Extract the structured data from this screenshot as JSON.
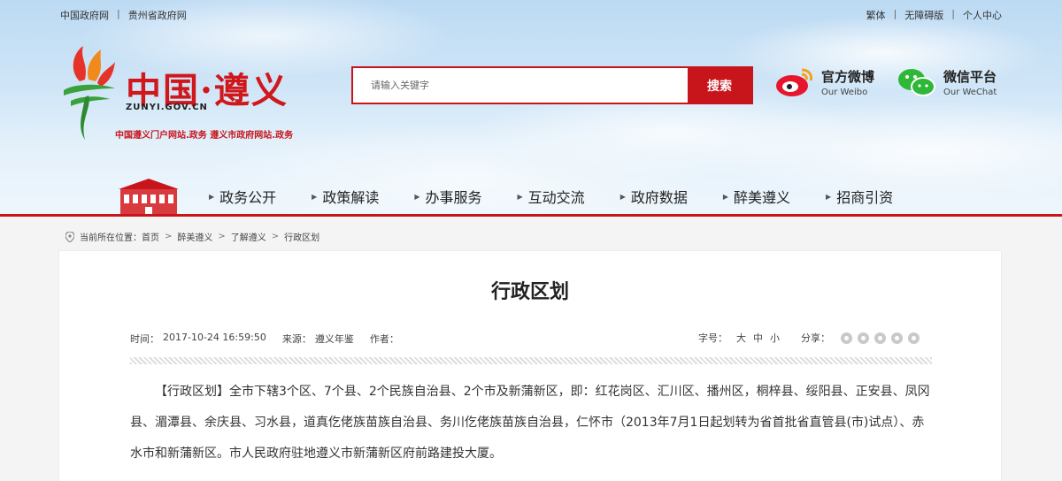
{
  "topbar": {
    "left_links": [
      "中国政府网",
      "贵州省政府网"
    ],
    "right_links": [
      "繁体",
      "无障碍版",
      "个人中心"
    ]
  },
  "logo": {
    "title": "中国·遵义",
    "url_text": "ZUNYI.GOV.CN",
    "subtitle": "中国遵义门户网站.政务  遵义市政府网站.政务"
  },
  "search": {
    "placeholder": "请输入关键字",
    "button_label": "搜索"
  },
  "social": {
    "weibo": {
      "title": "官方微博",
      "subtitle": "Our Weibo"
    },
    "wechat": {
      "title": "微信平台",
      "subtitle": "Our WeChat"
    }
  },
  "nav": {
    "items": [
      "政务公开",
      "政策解读",
      "办事服务",
      "互动交流",
      "政府数据",
      "醉美遵义",
      "招商引资"
    ]
  },
  "breadcrumb": {
    "label": "当前所在位置：",
    "items": [
      "首页",
      "醉美遵义",
      "了解遵义",
      "行政区划"
    ]
  },
  "article": {
    "title": "行政区划",
    "time_label": "时间：",
    "time": "2017-10-24 16:59:50",
    "source_label": "来源：",
    "source": "遵义年鉴",
    "author_label": "作者：",
    "font_size_label": "字号：",
    "font_sizes": [
      "大",
      "中",
      "小"
    ],
    "share_label": "分享：",
    "share_icons": [
      "plus-share-icon",
      "qzone-share-icon",
      "weibo-share-icon",
      "wechat-share-icon",
      "favorite-share-icon"
    ],
    "content": "【行政区划】全市下辖3个区、7个县、2个民族自治县、2个市及新蒲新区，即：红花岗区、汇川区、播州区，桐梓县、绥阳县、正安县、凤冈县、湄潭县、余庆县、习水县，道真仡佬族苗族自治县、务川仡佬族苗族自治县，仁怀市（2013年7月1日起划转为省首批省直管县(市)试点）、赤水市和新蒲新区。市人民政府驻地遵义市新蒲新区府前路建投大厦。"
  },
  "colors": {
    "brand_red": "#c8151b",
    "sky_blue": "#cfe5f7"
  }
}
